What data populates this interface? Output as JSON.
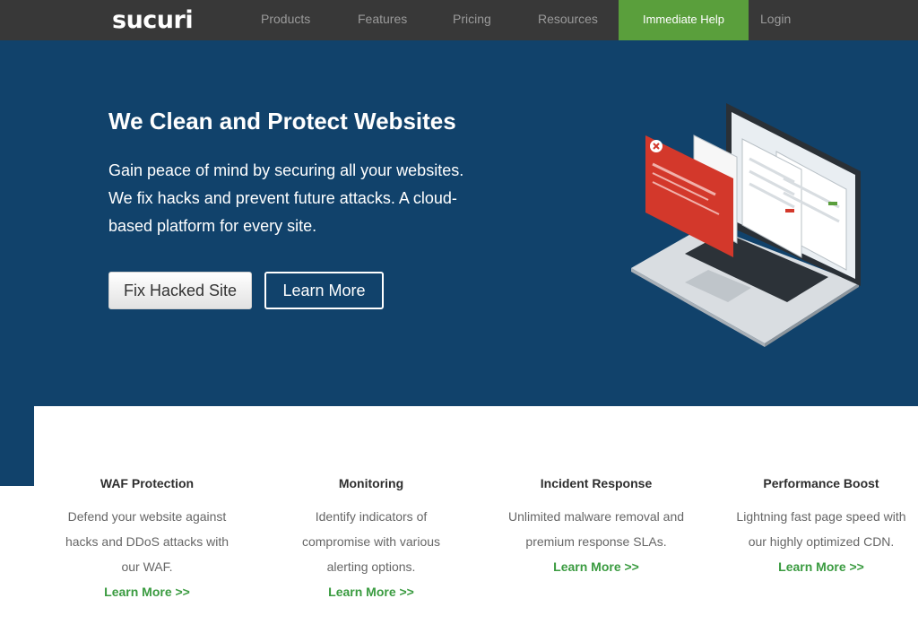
{
  "nav": {
    "logo": "sucuri",
    "items": [
      {
        "label": "Products"
      },
      {
        "label": "Features"
      },
      {
        "label": "Pricing"
      },
      {
        "label": "Resources"
      }
    ],
    "cta": "Immediate Help",
    "login": "Login"
  },
  "hero": {
    "title": "We Clean and Protect Websites",
    "subtitle": "Gain peace of mind by securing all your websites. We fix hacks and prevent future attacks. A cloud-based platform for every site.",
    "primary_button": "Fix Hacked Site",
    "secondary_button": "Learn More"
  },
  "features": [
    {
      "title": "WAF Protection",
      "description": "Defend your website against hacks and DDoS attacks with our WAF.",
      "link": "Learn More >>"
    },
    {
      "title": "Monitoring",
      "description": "Identify indicators of compromise with various alerting options.",
      "link": "Learn More >>"
    },
    {
      "title": "Incident Response",
      "description": "Unlimited malware removal and premium response SLAs.",
      "link": "Learn More >>"
    },
    {
      "title": "Performance Boost",
      "description": "Lightning fast page speed with our highly optimized CDN.",
      "link": "Learn More >>"
    }
  ],
  "colors": {
    "nav_bg": "#383838",
    "hero_bg": "#11426b",
    "cta_green": "#5a9f3c",
    "link_green": "#3a9b40"
  }
}
